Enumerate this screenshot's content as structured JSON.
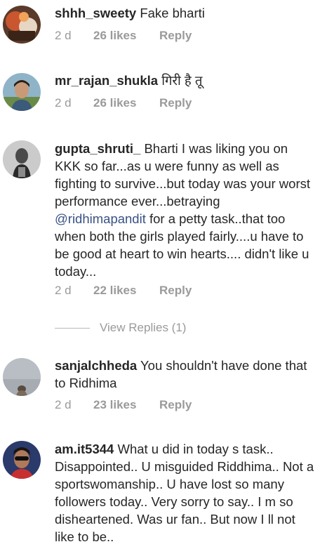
{
  "comments": [
    {
      "username": "shhh_sweety",
      "text": "Fake bharti",
      "time": "2 d",
      "likes": "26 likes",
      "reply": "Reply"
    },
    {
      "username": "mr_rajan_shukla",
      "text": "गिरी है तू",
      "time": "2 d",
      "likes": "26 likes",
      "reply": "Reply"
    },
    {
      "username": "gupta_shruti_",
      "text": "Bharti I was liking you on KKK so far...as u were funny as well as fighting to survive...but today was your worst performance ever...betraying",
      "mention": "@ridhimapandit",
      "text_after": "for a petty task..that too when both the girls played fairly....u have to be good at heart to win hearts.... didn't like u today...",
      "time": "2 d",
      "likes": "22 likes",
      "reply": "Reply",
      "view_replies": "View Replies (1)"
    },
    {
      "username": "sanjalchheda",
      "text": "You shouldn't have done that to Ridhima",
      "time": "2 d",
      "likes": "23 likes",
      "reply": "Reply"
    },
    {
      "username": "am.it5344",
      "text": "What u did in today s task.. Disappointed.. U misguided Riddhima.. Not a sportswomanship.. U have lost so many followers today.. Very sorry to say.. I m so disheartened.  Was ur fan.. But now I ll not like to be.."
    }
  ]
}
